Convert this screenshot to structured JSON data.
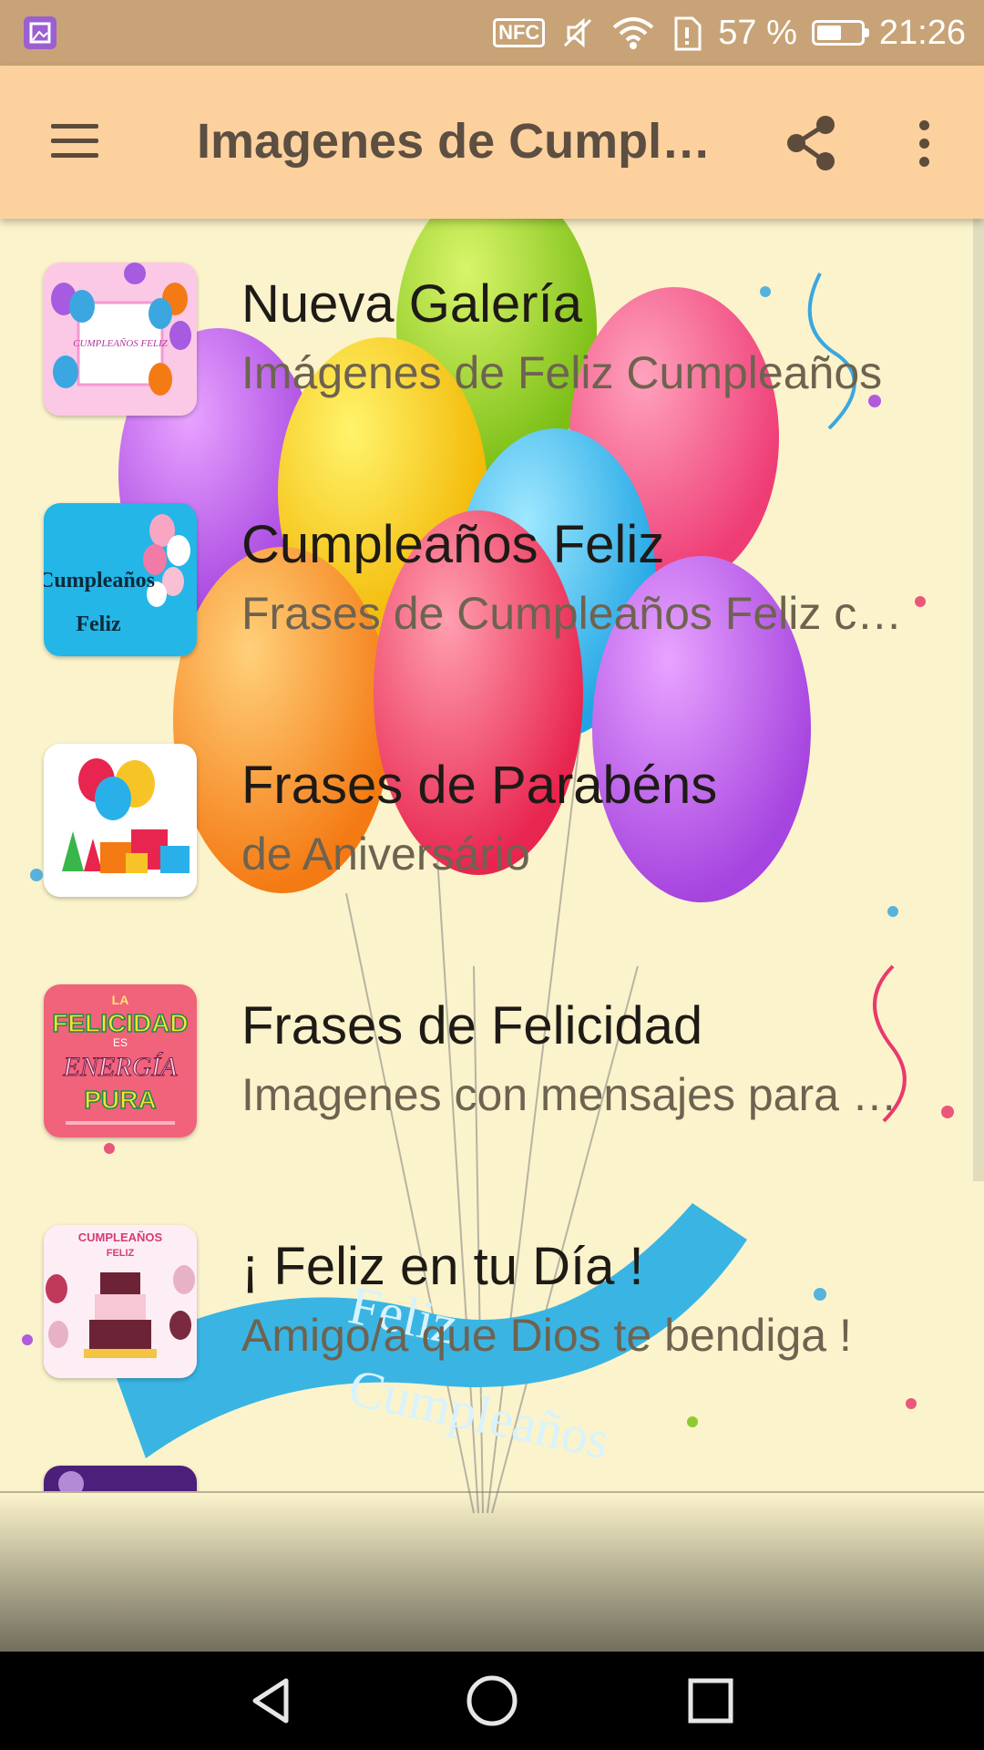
{
  "status_bar": {
    "battery_text": "57 %",
    "battery_level": 0.57,
    "time": "21:26",
    "icons": [
      "gallery-notification-icon",
      "nfc-icon",
      "silent-icon",
      "wifi-icon",
      "sim-alert-icon",
      "battery-icon"
    ],
    "nfc_label": "NFC"
  },
  "app_bar": {
    "title": "Imagenes de Cumpl…",
    "menu_icon": "hamburger-menu-icon",
    "share_icon": "share-icon",
    "more_icon": "more-vert-icon"
  },
  "list": {
    "items": [
      {
        "title": "Nueva Galería",
        "subtitle": "Imágenes de Feliz Cumpleaños",
        "thumb_text": "CUMPLEAÑOS FELIZ"
      },
      {
        "title": "Cumpleaños Feliz",
        "subtitle": "Frases de Cumpleaños Feliz c…",
        "thumb_text_1": "Cumpleaños",
        "thumb_text_2": "Feliz"
      },
      {
        "title": "Frases de Parabéns",
        "subtitle": "de Aniversário"
      },
      {
        "title": "Frases de Felicidad",
        "subtitle": "Imagenes con mensajes para …",
        "thumb_text_1": "LA",
        "thumb_text_2": "FELICIDAD",
        "thumb_text_3": "ES",
        "thumb_text_4": "ENERGÍA",
        "thumb_text_5": "PURA"
      },
      {
        "title": "¡ Feliz en tu Día !",
        "subtitle": "Amigo/a que Dios te bendiga !",
        "thumb_text_1": "CUMPLEAÑOS",
        "thumb_text_2": "FELIZ"
      }
    ]
  },
  "background": {
    "banner_text_1": "Feliz",
    "banner_text_2": "Cumpleaños"
  },
  "nav_bar": {
    "back_icon": "back-triangle-icon",
    "home_icon": "home-circle-icon",
    "recents_icon": "recents-square-icon"
  },
  "colors": {
    "status_bar": "#c8a377",
    "app_bar": "#fcd19e",
    "title_text": "#5d4e42",
    "item_title": "#1e1a16",
    "item_subtitle": "#6e6350"
  }
}
